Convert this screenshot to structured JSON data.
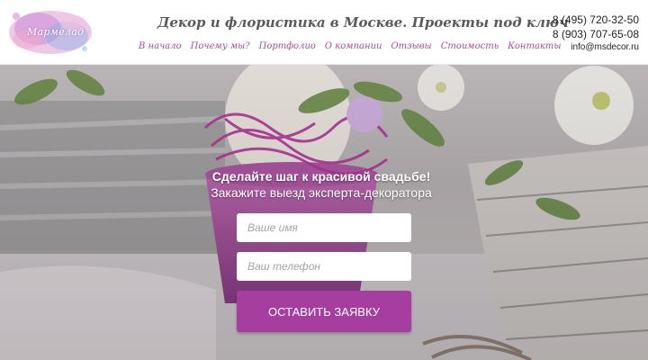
{
  "header": {
    "logo_text": "Мармелад",
    "tagline": "Декор и флористика в Москве. Проекты под ключ",
    "nav": [
      {
        "label": "В начало",
        "name": "nav-home"
      },
      {
        "label": "Почему мы?",
        "name": "nav-why-us"
      },
      {
        "label": "Портфолио",
        "name": "nav-portfolio"
      },
      {
        "label": "О компании",
        "name": "nav-about"
      },
      {
        "label": "Отзывы",
        "name": "nav-reviews"
      },
      {
        "label": "Стоимость",
        "name": "nav-pricing"
      },
      {
        "label": "Контакты",
        "name": "nav-contacts"
      }
    ],
    "contacts": {
      "phone1": "8 (495) 720-32-50",
      "phone2": "8 (903) 707-65-08",
      "email": "info@msdecor.ru"
    }
  },
  "hero": {
    "headline": "Сделайте шаг к красивой свадьбе!",
    "subline": "Закажите выезд эксперта-декоратора",
    "form": {
      "name_placeholder": "Ваше имя",
      "phone_placeholder": "Ваш телефон",
      "submit_label": "ОСТАВИТЬ ЗАЯВКУ"
    }
  },
  "colors": {
    "accent": "#a63ea0",
    "nav_link": "#b04aa0",
    "tagline": "#5a5a5a"
  }
}
